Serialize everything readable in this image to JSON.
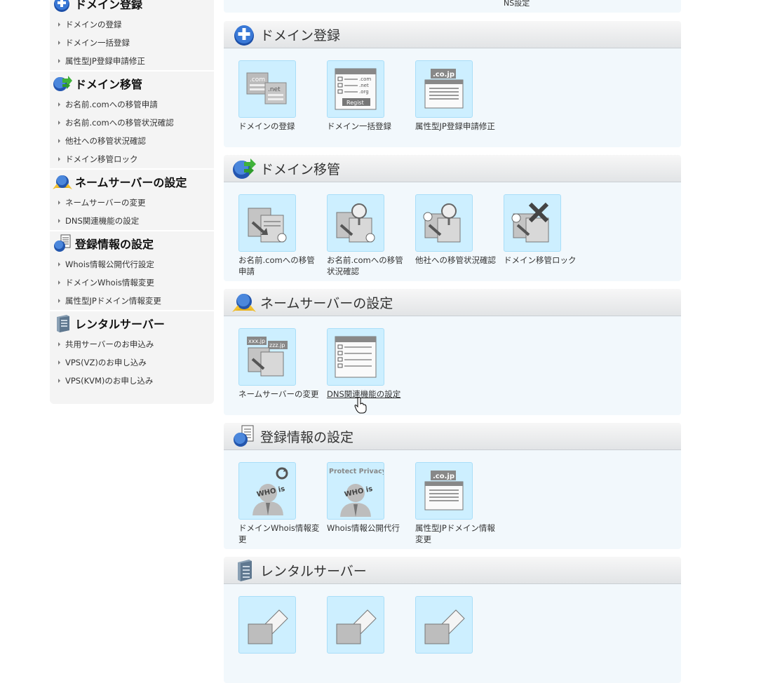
{
  "sidebar": {
    "groups": [
      {
        "title": "ドメイン登録",
        "icon": "plus-circle-icon",
        "items": [
          "ドメインの登録",
          "ドメイン一括登録",
          "属性型JP登録申請修正"
        ]
      },
      {
        "title": "ドメイン移管",
        "icon": "transfer-icon",
        "items": [
          "お名前.comへの移管申請",
          "お名前.comへの移管状況確認",
          "他社への移管状況確認",
          "ドメイン移管ロック"
        ]
      },
      {
        "title": "ネームサーバーの設定",
        "icon": "nameserver-icon",
        "items": [
          "ネームサーバーの変更",
          "DNS関連機能の設定"
        ]
      },
      {
        "title": "登録情報の設定",
        "icon": "registration-info-icon",
        "items": [
          "Whois情報公開代行設定",
          "ドメインWhois情報変更",
          "属性型JPドメイン情報変更"
        ]
      },
      {
        "title": "レンタルサーバー",
        "icon": "server-icon",
        "items": [
          "共用サーバーのお申込み",
          "VPS(VZ)のお申し込み",
          "VPS(KVM)のお申し込み"
        ]
      }
    ]
  },
  "main": {
    "top_stub_text": "NS設定",
    "sections": [
      {
        "title": "ドメイン登録",
        "icon": "plus-circle-icon",
        "tiles": [
          {
            "label": "ドメインの登録",
            "icon": "domain-register-icon",
            "art": [
              ".com",
              ".net"
            ]
          },
          {
            "label": "ドメイン一括登録",
            "icon": "bulk-register-icon",
            "art": [
              ".com",
              ".net",
              ".org",
              "Regist"
            ]
          },
          {
            "label": "属性型JP登録申請修正",
            "icon": "jp-register-fix-icon",
            "art": [
              ".co.jp"
            ]
          }
        ]
      },
      {
        "title": "ドメイン移管",
        "icon": "transfer-icon",
        "tiles": [
          {
            "label": "お名前.comへの移管申請",
            "icon": "transfer-request-icon"
          },
          {
            "label": "お名前.comへの移管状況確認",
            "icon": "transfer-status-icon"
          },
          {
            "label": "他社への移管状況確認",
            "icon": "outbound-transfer-status-icon"
          },
          {
            "label": "ドメイン移管ロック",
            "icon": "transfer-lock-icon"
          }
        ]
      },
      {
        "title": "ネームサーバーの設定",
        "icon": "nameserver-icon",
        "tiles": [
          {
            "label": "ネームサーバーの変更",
            "icon": "nameserver-change-icon",
            "art": [
              "xxx.jp",
              "zzz.jp"
            ]
          },
          {
            "label": "DNS関連機能の設定",
            "icon": "dns-settings-icon"
          }
        ]
      },
      {
        "title": "登録情報の設定",
        "icon": "registration-info-icon",
        "tiles": [
          {
            "label": "ドメインWhois情報変更",
            "icon": "whois-change-icon",
            "art": [
              "WHO is"
            ]
          },
          {
            "label": "Whois情報公開代行",
            "icon": "whois-privacy-icon",
            "art": [
              "Protect Privacy",
              "WHO is"
            ]
          },
          {
            "label": "属性型JPドメイン情報変更",
            "icon": "jp-domain-info-icon",
            "art": [
              ".co.jp"
            ]
          }
        ]
      },
      {
        "title": "レンタルサーバー",
        "icon": "server-icon",
        "tiles": [
          {
            "label": "",
            "icon": "shared-server-icon"
          },
          {
            "label": "",
            "icon": "vps-vz-icon"
          },
          {
            "label": "",
            "icon": "vps-kvm-icon"
          }
        ]
      }
    ]
  },
  "colors": {
    "section_bg": "#f2f8fc",
    "tile_bg": "#cdefff",
    "sidebar_bg": "#f4f4f4"
  }
}
